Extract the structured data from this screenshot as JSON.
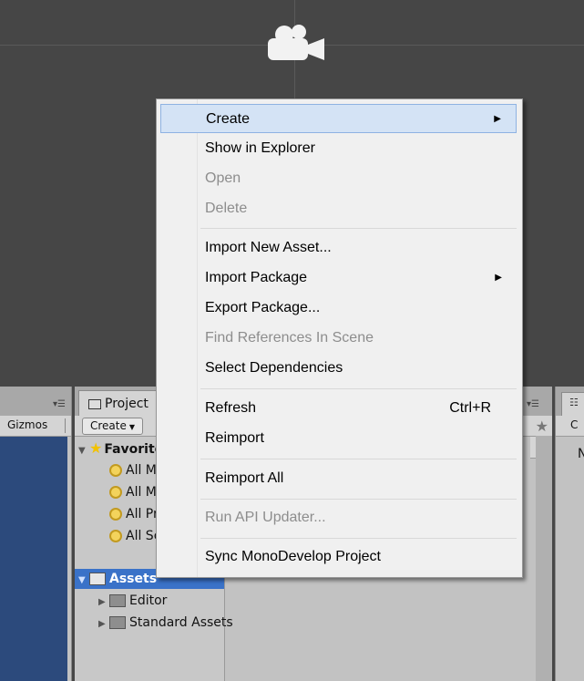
{
  "left_panel": {
    "toolbar_label": "Gizmos"
  },
  "project_panel": {
    "tab_label": "Project",
    "create_label": "Create",
    "favorites_label": "Favorites",
    "favorites": [
      "All Materials",
      "All Models",
      "All Prefabs",
      "All Scripts"
    ],
    "assets_label": "Assets",
    "asset_folders": [
      "Editor",
      "Standard Assets"
    ]
  },
  "right_panel": {
    "toolbar_text": "C",
    "letter": "N"
  },
  "context_menu": {
    "create": "Create",
    "show_in_explorer": "Show in Explorer",
    "open": "Open",
    "delete": "Delete",
    "import_new_asset": "Import New Asset...",
    "import_package": "Import Package",
    "export_package": "Export Package...",
    "find_references": "Find References In Scene",
    "select_dependencies": "Select Dependencies",
    "refresh": "Refresh",
    "refresh_shortcut": "Ctrl+R",
    "reimport": "Reimport",
    "reimport_all": "Reimport All",
    "run_api_updater": "Run API Updater...",
    "sync_monodevelop": "Sync MonoDevelop Project"
  }
}
